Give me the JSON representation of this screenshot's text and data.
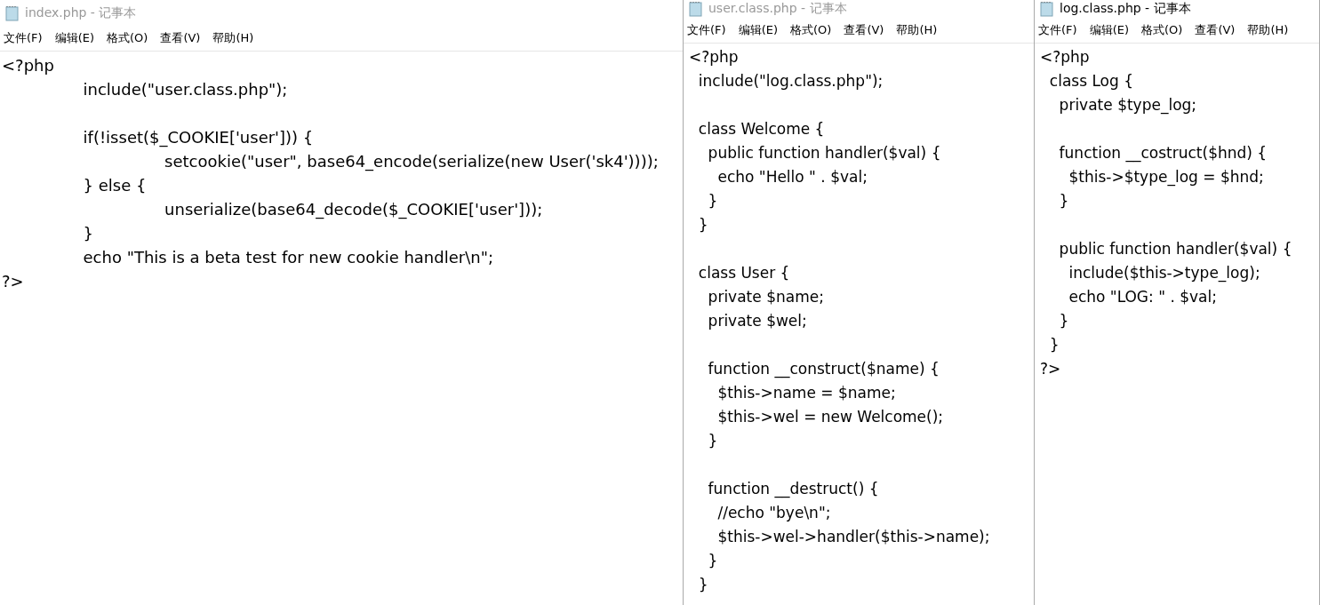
{
  "windows": [
    {
      "title": "index.php - 记事本",
      "active": false,
      "menu": [
        "文件(F)",
        "编辑(E)",
        "格式(O)",
        "查看(V)",
        "帮助(H)"
      ],
      "blocks": [
        [
          "<?php",
          "\tinclude(\"user.class.php\");"
        ],
        [
          "\tif(!isset($_COOKIE['user'])) {",
          "\t\tsetcookie(\"user\", base64_encode(serialize(new User('sk4'))));",
          "\t} else {",
          "\t\tunserialize(base64_decode($_COOKIE['user']));",
          "\t}",
          "\techo \"This is a beta test for new cookie handler\\n\";",
          "?>"
        ]
      ]
    },
    {
      "title": "user.class.php - 记事本",
      "active": false,
      "menu": [
        "文件(F)",
        "编辑(E)",
        "格式(O)",
        "查看(V)",
        "帮助(H)"
      ],
      "blocks": [
        [
          "<?php",
          "  include(\"log.class.php\");"
        ],
        [
          "  class Welcome {",
          "    public function handler($val) {",
          "      echo \"Hello \" . $val;",
          "    }",
          "  }"
        ],
        [
          "  class User {",
          "    private $name;",
          "    private $wel;"
        ],
        [
          "    function __construct($name) {",
          "      $this->name = $name;",
          "      $this->wel = new Welcome();",
          "    }"
        ],
        [
          "    function __destruct() {",
          "      //echo \"bye\\n\";",
          "      $this->wel->handler($this->name);",
          "    }",
          "  }"
        ]
      ]
    },
    {
      "title": "log.class.php - 记事本",
      "active": true,
      "menu": [
        "文件(F)",
        "编辑(E)",
        "格式(O)",
        "查看(V)",
        "帮助(H)"
      ],
      "blocks": [
        [
          "<?php",
          "  class Log {",
          "    private $type_log;"
        ],
        [
          "    function __costruct($hnd) {",
          "      $this->$type_log = $hnd;",
          "    }"
        ],
        [
          "    public function handler($val) {",
          "      include($this->type_log);",
          "      echo \"LOG: \" . $val;",
          "    }",
          "  }",
          "?>"
        ]
      ]
    }
  ]
}
